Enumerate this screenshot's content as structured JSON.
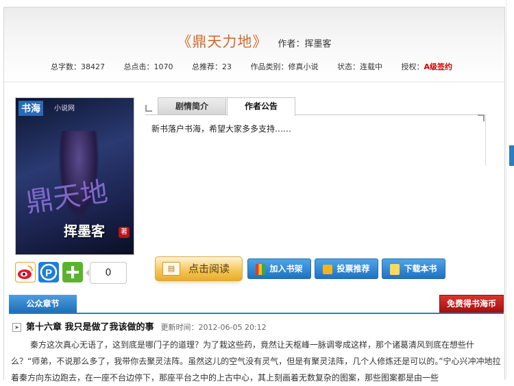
{
  "book": {
    "title": "《鼎天力地》",
    "author_label": "作者：挥墨客"
  },
  "stats": {
    "word_count": "总字数：38427",
    "total_clicks": "总点击：1070",
    "total_recommends": "总推荐：23",
    "category": "作品类别：修真小说",
    "status": "状态：连载中",
    "license_label": "授权：",
    "license_value": "A级签约"
  },
  "cover": {
    "brand": "书海",
    "brand_sub": "小说网",
    "big_title": "鼎天地",
    "author": "挥墨客",
    "seal": "著"
  },
  "share": {
    "count": "0"
  },
  "tabs": {
    "intro": "剧情简介",
    "notice": "作者公告",
    "notice_text": "新书落户书海，希望大家多多支持……"
  },
  "actions": {
    "read": "点击阅读",
    "add_shelf": "加入书架",
    "vote": "投票推荐",
    "download": "下载本书"
  },
  "chapters": {
    "tab_label": "公众章节",
    "free_button": "免费得书海币",
    "latest_title": "第十六章  我只是做了我该做的事",
    "update_time": "更新时间：2012-06-05 20:12",
    "excerpt": "秦方这次真心无语了，这到底是哪门子的道理？为了栽这些药，竟然让天枢峰一脉调零成这样，那个诸葛清风到底在想些什么？“师弟，不说那么多了，我带你去聚灵法阵。虽然这儿的空气没有灵气，但是有聚灵法阵，几个人修炼还是可以的。”宁心兴冲冲地拉着秦方向东边跑去，在一座不台边停下，那座平台之中的上古中心，其上刻画着无数复杂的图案，那些图案都是由一些"
  },
  "colors": {
    "title": "#d2692a",
    "accent_blue": "#1e72c2",
    "contract_red": "#cc0000"
  }
}
